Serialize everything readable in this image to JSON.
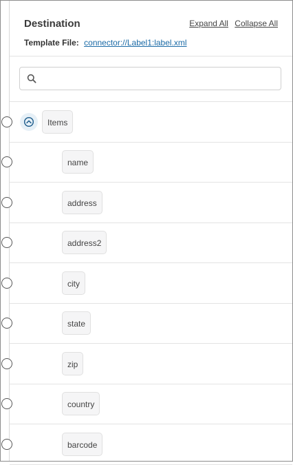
{
  "header": {
    "title": "Destination",
    "expand_all": "Expand All",
    "collapse_all": "Collapse All",
    "template_label": "Template File:",
    "template_link": "connector://Label1:label.xml"
  },
  "search": {
    "placeholder": "",
    "value": "",
    "icon": "search-icon"
  },
  "tree": {
    "parent": {
      "label": "Items",
      "expanded": true,
      "toggle_icon": "chevron-up-circle-icon"
    },
    "children": [
      {
        "label": "name"
      },
      {
        "label": "address"
      },
      {
        "label": "address2"
      },
      {
        "label": "city"
      },
      {
        "label": "state"
      },
      {
        "label": "zip"
      },
      {
        "label": "country"
      },
      {
        "label": "barcode"
      }
    ]
  },
  "colors": {
    "link": "#1a6aa6",
    "toggle_bg": "#e6f0f7",
    "chip_bg": "#f5f5f6"
  }
}
